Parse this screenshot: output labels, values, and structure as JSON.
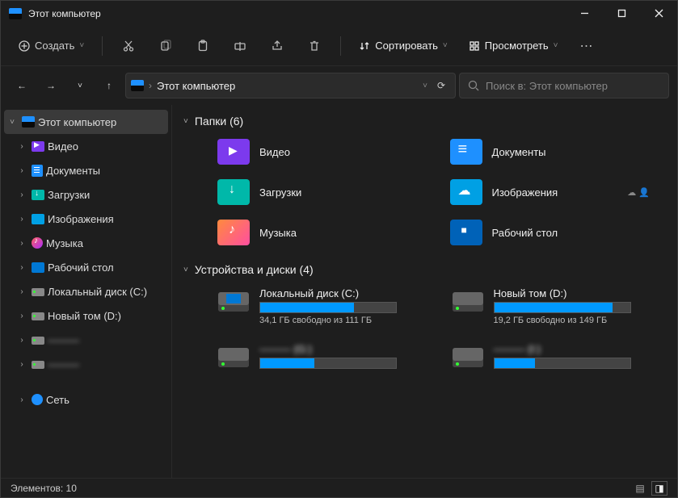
{
  "title": "Этот компьютер",
  "toolbar": {
    "create": "Создать",
    "sort": "Сортировать",
    "view": "Просмотреть"
  },
  "breadcrumb": "Этот компьютер",
  "search_placeholder": "Поиск в: Этот компьютер",
  "sidebar": [
    {
      "label": "Этот компьютер",
      "icon": "pc",
      "selected": true,
      "chev": "˅"
    },
    {
      "label": "Видео",
      "icon": "purple",
      "chev": ">"
    },
    {
      "label": "Документы",
      "icon": "doc",
      "chev": ">"
    },
    {
      "label": "Загрузки",
      "icon": "teal",
      "chev": ">"
    },
    {
      "label": "Изображения",
      "icon": "sky",
      "chev": ">"
    },
    {
      "label": "Музыка",
      "icon": "music",
      "chev": ">"
    },
    {
      "label": "Рабочий стол",
      "icon": "blue",
      "chev": ">"
    },
    {
      "label": "Локальный диск (C:)",
      "icon": "drive",
      "chev": ">"
    },
    {
      "label": "Новый том (D:)",
      "icon": "drive",
      "chev": ">"
    },
    {
      "label": "———",
      "icon": "drive",
      "chev": ">",
      "blur": true
    },
    {
      "label": "———",
      "icon": "drive",
      "chev": ">",
      "blur": true
    },
    {
      "label": "Сеть",
      "icon": "net",
      "chev": ">",
      "gap": true
    }
  ],
  "groups": {
    "folders": {
      "title": "Папки (6)"
    },
    "drives": {
      "title": "Устройства и диски (4)"
    }
  },
  "folders": [
    {
      "label": "Видео",
      "icon": "purple"
    },
    {
      "label": "Документы",
      "icon": "blue"
    },
    {
      "label": "Загрузки",
      "icon": "teal"
    },
    {
      "label": "Изображения",
      "icon": "sky",
      "cloud": true
    },
    {
      "label": "Музыка",
      "icon": "orange"
    },
    {
      "label": "Рабочий стол",
      "icon": "darkblue"
    }
  ],
  "drives": [
    {
      "name": "Локальный диск (C:)",
      "free": "34,1 ГБ свободно из 111 ГБ",
      "pct": 69,
      "os": true
    },
    {
      "name": "Новый том (D:)",
      "free": "19,2 ГБ свободно из 149 ГБ",
      "pct": 87
    },
    {
      "name": "——— (G:)",
      "free": "",
      "pct": 40,
      "blur": true
    },
    {
      "name": "——— (I:)",
      "free": "",
      "pct": 30,
      "blur": true
    }
  ],
  "status": {
    "items": "Элементов: 10"
  }
}
